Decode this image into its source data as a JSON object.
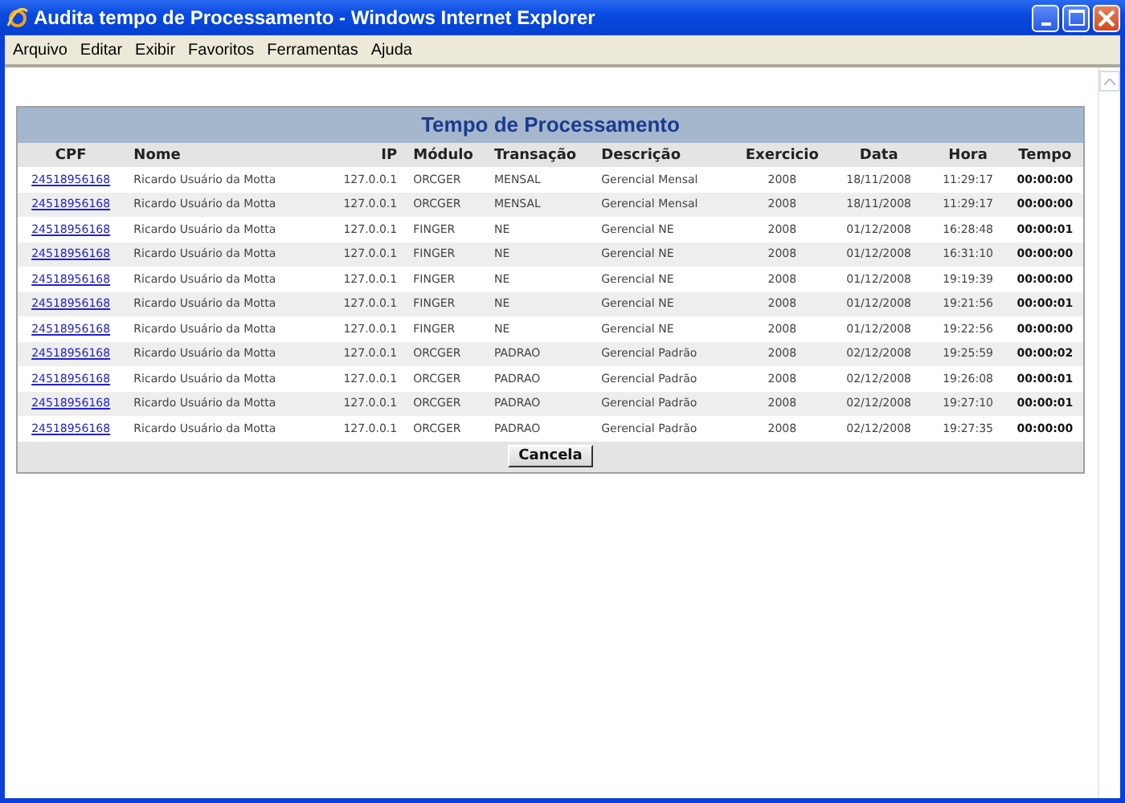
{
  "window": {
    "title": "Audita tempo de Processamento - Windows Internet Explorer"
  },
  "menu": [
    "Arquivo",
    "Editar",
    "Exibir",
    "Favoritos",
    "Ferramentas",
    "Ajuda"
  ],
  "panel": {
    "title": "Tempo de Processamento",
    "columns": [
      "CPF",
      "Nome",
      "IP",
      "Módulo",
      "Transação",
      "Descrição",
      "Exercicio",
      "Data",
      "Hora",
      "Tempo"
    ],
    "rows": [
      [
        "24518956168",
        "Ricardo Usuário da Motta",
        "127.0.0.1",
        "ORCGER",
        "MENSAL",
        "Gerencial Mensal",
        "2008",
        "18/11/2008",
        "11:29:17",
        "00:00:00"
      ],
      [
        "24518956168",
        "Ricardo Usuário da Motta",
        "127.0.0.1",
        "ORCGER",
        "MENSAL",
        "Gerencial Mensal",
        "2008",
        "18/11/2008",
        "11:29:17",
        "00:00:00"
      ],
      [
        "24518956168",
        "Ricardo Usuário da Motta",
        "127.0.0.1",
        "FINGER",
        "NE",
        "Gerencial NE",
        "2008",
        "01/12/2008",
        "16:28:48",
        "00:00:01"
      ],
      [
        "24518956168",
        "Ricardo Usuário da Motta",
        "127.0.0.1",
        "FINGER",
        "NE",
        "Gerencial NE",
        "2008",
        "01/12/2008",
        "16:31:10",
        "00:00:00"
      ],
      [
        "24518956168",
        "Ricardo Usuário da Motta",
        "127.0.0.1",
        "FINGER",
        "NE",
        "Gerencial NE",
        "2008",
        "01/12/2008",
        "19:19:39",
        "00:00:00"
      ],
      [
        "24518956168",
        "Ricardo Usuário da Motta",
        "127.0.0.1",
        "FINGER",
        "NE",
        "Gerencial NE",
        "2008",
        "01/12/2008",
        "19:21:56",
        "00:00:01"
      ],
      [
        "24518956168",
        "Ricardo Usuário da Motta",
        "127.0.0.1",
        "FINGER",
        "NE",
        "Gerencial NE",
        "2008",
        "01/12/2008",
        "19:22:56",
        "00:00:00"
      ],
      [
        "24518956168",
        "Ricardo Usuário da Motta",
        "127.0.0.1",
        "ORCGER",
        "PADRAO",
        "Gerencial Padrão",
        "2008",
        "02/12/2008",
        "19:25:59",
        "00:00:02"
      ],
      [
        "24518956168",
        "Ricardo Usuário da Motta",
        "127.0.0.1",
        "ORCGER",
        "PADRAO",
        "Gerencial Padrão",
        "2008",
        "02/12/2008",
        "19:26:08",
        "00:00:01"
      ],
      [
        "24518956168",
        "Ricardo Usuário da Motta",
        "127.0.0.1",
        "ORCGER",
        "PADRAO",
        "Gerencial Padrão",
        "2008",
        "02/12/2008",
        "19:27:10",
        "00:00:01"
      ],
      [
        "24518956168",
        "Ricardo Usuário da Motta",
        "127.0.0.1",
        "ORCGER",
        "PADRAO",
        "Gerencial Padrão",
        "2008",
        "02/12/2008",
        "19:27:35",
        "00:00:00"
      ]
    ],
    "button": "Cancela"
  }
}
